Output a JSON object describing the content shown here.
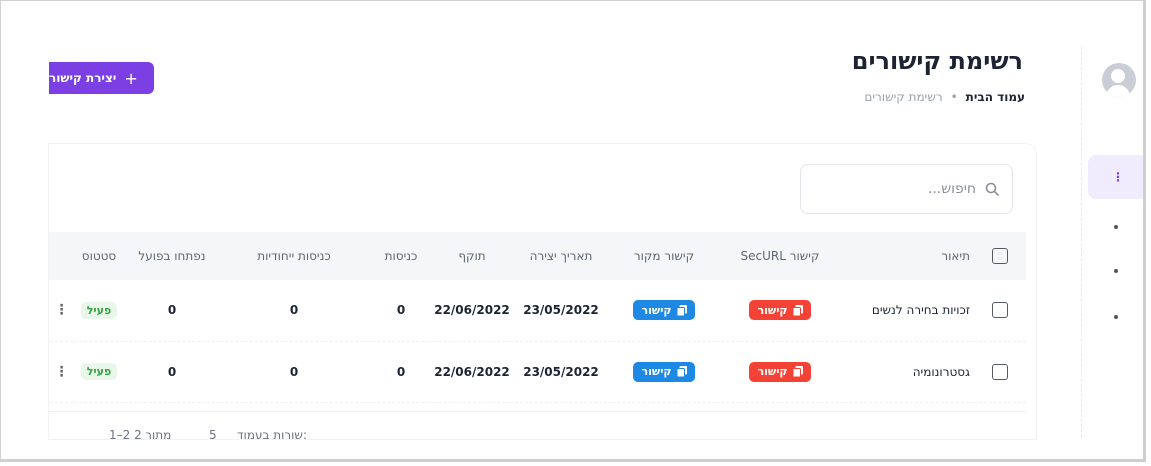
{
  "header": {
    "title": "רשימת קישורים",
    "breadcrumb": {
      "home": "עמוד הבית",
      "separator": "•",
      "current": "רשימת קישורים"
    },
    "create_button": {
      "label": "יצירת קישור",
      "plus": "+"
    }
  },
  "search": {
    "placeholder": "חיפוש...",
    "value": ""
  },
  "table": {
    "headers": [
      "תיאור",
      "קישור SecURL",
      "קישור מקור",
      "תאריך יצירה",
      "תוקף",
      "כניסות",
      "כניסות ייחודיות",
      "נפתחו בפועל",
      "סטטוס"
    ],
    "rows": [
      {
        "description": "זכויות בחירה לנשים",
        "securl_link": "קישור",
        "source_link": "קישור",
        "created": "23/05/2022",
        "expiry": "22/06/2022",
        "entries": "0",
        "unique_entries": "0",
        "opened": "0",
        "status": "פעיל",
        "more": "⋮"
      },
      {
        "description": "גסטרונומיה",
        "securl_link": "קישור",
        "source_link": "קישור",
        "created": "23/05/2022",
        "expiry": "22/06/2022",
        "entries": "0",
        "unique_entries": "0",
        "opened": "0",
        "status": "פעיל",
        "more": "⋮"
      }
    ]
  },
  "pagination": {
    "rows_per_page_label": "שורות בעמוד:",
    "rows_per_page": "5",
    "range": "1–2 מתוך 2"
  },
  "colors": {
    "accent": "#7b3fe4",
    "securl_pill": "#f44336",
    "source_pill": "#1e88e5",
    "status_active_bg": "#e8f7e9",
    "status_active_text": "#3aa346"
  }
}
